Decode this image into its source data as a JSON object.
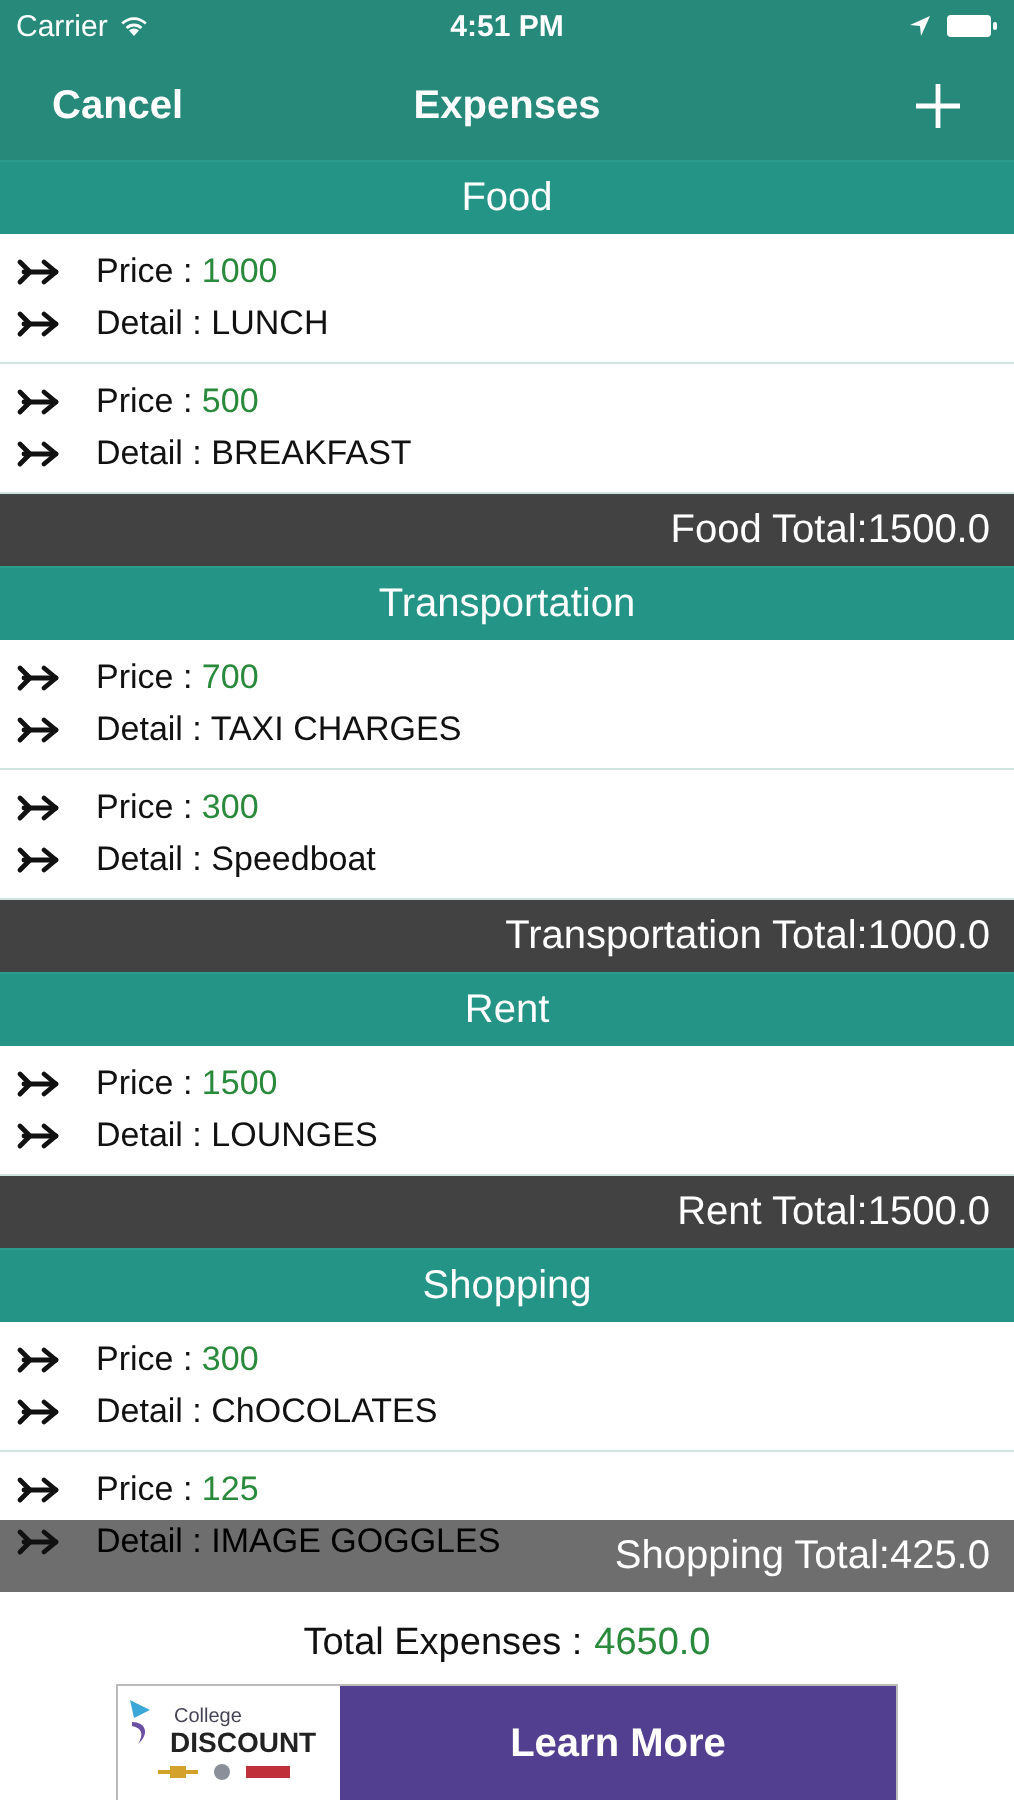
{
  "status_bar": {
    "carrier": "Carrier",
    "time": "4:51 PM"
  },
  "nav_bar": {
    "left_button": "Cancel",
    "title": "Expenses"
  },
  "sections": [
    {
      "title": "Food",
      "items": [
        {
          "price_label": "Price :",
          "price": "1000",
          "detail_label": "Detail :",
          "detail": "LUNCH"
        },
        {
          "price_label": "Price :",
          "price": "500",
          "detail_label": "Detail :",
          "detail": "BREAKFAST"
        }
      ],
      "total": "Food Total:1500.0"
    },
    {
      "title": "Transportation",
      "items": [
        {
          "price_label": "Price :",
          "price": "700",
          "detail_label": "Detail :",
          "detail": "TAXI CHARGES"
        },
        {
          "price_label": "Price :",
          "price": "300",
          "detail_label": "Detail :",
          "detail": "Speedboat"
        }
      ],
      "total": "Transportation Total:1000.0"
    },
    {
      "title": "Rent",
      "items": [
        {
          "price_label": "Price :",
          "price": "1500",
          "detail_label": "Detail :",
          "detail": "LOUNGES"
        }
      ],
      "total": "Rent Total:1500.0"
    },
    {
      "title": "Shopping",
      "items": [
        {
          "price_label": "Price :",
          "price": "300",
          "detail_label": "Detail :",
          "detail": "ChOCOLATES"
        },
        {
          "price_label": "Price :",
          "price": "125",
          "detail_label": "Detail :",
          "detail": "IMAGE GOGGLES"
        }
      ],
      "total": "Shopping Total:425.0"
    }
  ],
  "summary": {
    "label": "Total Expenses :",
    "value": "4650.0"
  },
  "ad": {
    "brand_top": "College",
    "brand_main": "DISCOUNT",
    "button": "Learn More"
  }
}
